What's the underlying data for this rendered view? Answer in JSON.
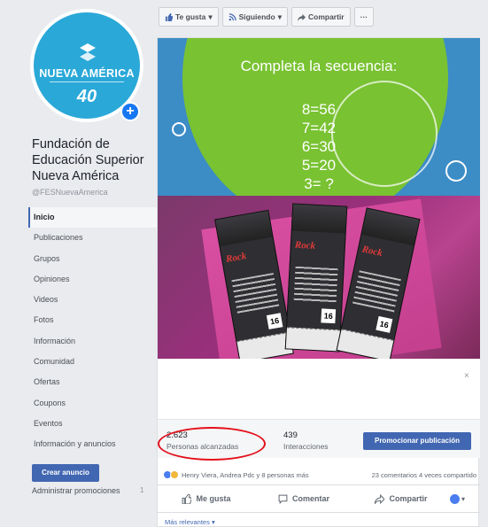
{
  "sidebar": {
    "logo_text": "NUEVA AMÉRICA",
    "logo_years": "40",
    "page_name": "Fundación de Educación Superior Nueva América",
    "handle": "@FESNuevaAmerica",
    "nav": [
      {
        "label": "Inicio"
      },
      {
        "label": "Publicaciones"
      },
      {
        "label": "Grupos"
      },
      {
        "label": "Opiniones"
      },
      {
        "label": "Videos"
      },
      {
        "label": "Fotos"
      },
      {
        "label": "Información"
      },
      {
        "label": "Comunidad"
      },
      {
        "label": "Ofertas"
      },
      {
        "label": "Coupons"
      },
      {
        "label": "Eventos"
      },
      {
        "label": "Información y anuncios"
      }
    ],
    "create_ad_label": "Crear anuncio",
    "admin_promos_label": "Administrar promociones",
    "admin_promos_count": "1"
  },
  "topbar": {
    "like_label": "Te gusta",
    "following_label": "Siguiendo",
    "share_label": "Compartir",
    "more_label": "···"
  },
  "post": {
    "puzzle_title": "Completa la secuencia:",
    "sequence": [
      "8=56",
      "7=42",
      "6=30",
      "5=20",
      "3= ?"
    ],
    "ticket_word": "Rock",
    "ticket_number": "16",
    "reach_value": "2.623",
    "reach_label": "Personas alcanzadas",
    "interactions_value": "439",
    "interactions_label": "Interacciones",
    "promote_label": "Promocionar publicación",
    "reactions_text": "Henry Viera, Andrea Pdc y 8 personas más",
    "comments_shares": "23 comentarios  4 veces compartido",
    "like_action": "Me gusta",
    "comment_action": "Comentar",
    "share_action": "Compartir",
    "relevant_label": "Más relevantes ▾",
    "close_label": "×"
  },
  "colors": {
    "brand_blue": "#4267b2",
    "highlight_red": "#e3101b",
    "puzzle_green": "#79c232",
    "puzzle_blue": "#3c8cc6"
  }
}
